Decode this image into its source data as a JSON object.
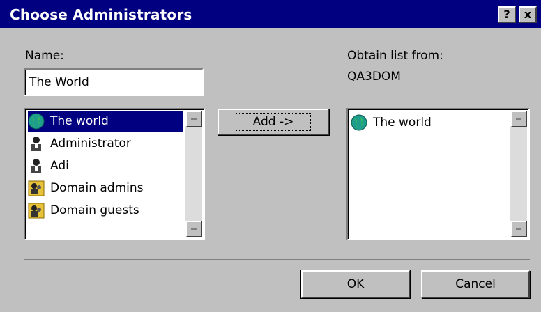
{
  "window": {
    "title": "Choose Administrators",
    "help_label": "?",
    "close_label": "x"
  },
  "name_field": {
    "label": "Name:",
    "value": "The World"
  },
  "obtain": {
    "label": "Obtain list from:",
    "value": "QA3DOM"
  },
  "source_list": {
    "items": [
      {
        "label": "The world",
        "icon": "globe-icon",
        "selected": true
      },
      {
        "label": "Administrator",
        "icon": "user-icon",
        "selected": false
      },
      {
        "label": "Adi",
        "icon": "user-icon",
        "selected": false
      },
      {
        "label": "Domain admins",
        "icon": "group-icon",
        "selected": false
      },
      {
        "label": "Domain guests",
        "icon": "group-icon",
        "selected": false
      }
    ]
  },
  "add_button": {
    "label": "Add ->"
  },
  "selected_list": {
    "items": [
      {
        "label": "The world",
        "icon": "globe-icon"
      }
    ]
  },
  "buttons": {
    "ok": "OK",
    "cancel": "Cancel"
  },
  "colors": {
    "titlebar": "#000080",
    "face": "#c0c0c0",
    "selection": "#000080"
  }
}
